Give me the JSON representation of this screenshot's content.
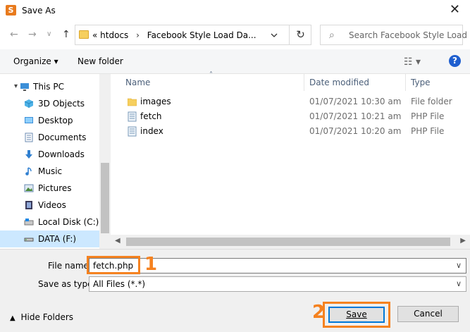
{
  "window": {
    "title": "Save As",
    "app_icon": "sublime-text-icon"
  },
  "navigation": {
    "back_icon": "back-arrow-icon",
    "forward_icon": "forward-arrow-icon",
    "recent_icon": "chevron-down-icon",
    "up_icon": "up-arrow-icon",
    "breadcrumb_overflow": "«",
    "breadcrumb": [
      "htdocs",
      "Facebook Style Load Da..."
    ],
    "search_placeholder": "Search Facebook Style Load ..."
  },
  "toolbar": {
    "organize_label": "Organize ▾",
    "new_folder_label": "New folder",
    "help_label": "?"
  },
  "sidebar": {
    "items": [
      {
        "label": "This PC",
        "icon": "computer-icon"
      },
      {
        "label": "3D Objects",
        "icon": "3d-objects-icon"
      },
      {
        "label": "Desktop",
        "icon": "desktop-icon"
      },
      {
        "label": "Documents",
        "icon": "documents-icon"
      },
      {
        "label": "Downloads",
        "icon": "downloads-icon"
      },
      {
        "label": "Music",
        "icon": "music-icon"
      },
      {
        "label": "Pictures",
        "icon": "pictures-icon"
      },
      {
        "label": "Videos",
        "icon": "videos-icon"
      },
      {
        "label": "Local Disk (C:)",
        "icon": "drive-icon"
      },
      {
        "label": "DATA (F:)",
        "icon": "drive-icon",
        "selected": true
      }
    ]
  },
  "file_list": {
    "columns": [
      "Name",
      "Date modified",
      "Type"
    ],
    "rows": [
      {
        "name": "images",
        "date": "01/07/2021 10:30 am",
        "type": "File folder",
        "icon": "folder-icon"
      },
      {
        "name": "fetch",
        "date": "01/07/2021 10:21 am",
        "type": "PHP File",
        "icon": "php-file-icon"
      },
      {
        "name": "index",
        "date": "01/07/2021 10:20 am",
        "type": "PHP File",
        "icon": "php-file-icon"
      }
    ]
  },
  "form": {
    "file_name_label": "File name:",
    "file_name_value": "fetch.php",
    "save_type_label": "Save as type:",
    "save_type_value": "All Files (*.*)"
  },
  "annotations": {
    "step1": "1",
    "step2": "2",
    "highlight_color": "#f58220"
  },
  "buttons": {
    "hide_folders": "Hide Folders",
    "save": "Save",
    "cancel": "Cancel"
  }
}
